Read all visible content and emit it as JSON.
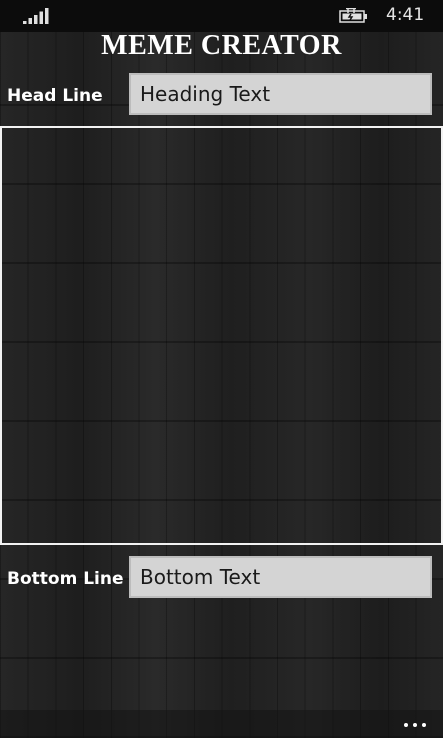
{
  "status_bar": {
    "time": "4:41",
    "signal_icon": "signal-bars-icon",
    "battery_icon": "battery-charging-icon"
  },
  "app": {
    "title": "MEME CREATOR"
  },
  "head_line": {
    "label": "Head Line",
    "value": "Heading Text"
  },
  "bottom_line": {
    "label": "Bottom Line",
    "value": "Bottom Text"
  },
  "canvas": {
    "border_color": "#f2f2f2"
  },
  "app_bar": {
    "more_icon": "ellipsis-icon"
  },
  "colors": {
    "background": "#232323",
    "field_background": "#d4d4d4",
    "text": "#ffffff"
  }
}
